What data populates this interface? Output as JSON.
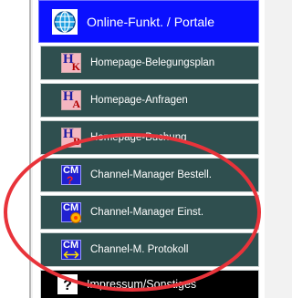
{
  "header": {
    "label": "Online-Funkt. / Portale",
    "icon": "globe-icon"
  },
  "items": [
    {
      "label": "Homepage-Belegungsplan",
      "icon": "homepage-k-icon",
      "sub": "K"
    },
    {
      "label": "Homepage-Anfragen",
      "icon": "homepage-a-icon",
      "sub": "A"
    },
    {
      "label": "Homepage-Buchung",
      "icon": "homepage-b-icon",
      "sub": "B"
    },
    {
      "label": "Channel-Manager Bestell.",
      "icon": "channel-manager-question-icon"
    },
    {
      "label": "Channel-Manager Einst.",
      "icon": "channel-manager-settings-icon"
    },
    {
      "label": "Channel-M. Protokoll",
      "icon": "channel-manager-protocol-icon"
    }
  ],
  "footer_item": {
    "label": "Impressum/Sonstiges",
    "icon": "question-mark-icon"
  },
  "icon_letters": {
    "homepage": "H",
    "channel_manager": "CM"
  },
  "colors": {
    "header_bg": "#0a10ff",
    "item_bg": "#2f4f4f",
    "highlight": "#e8333a"
  }
}
